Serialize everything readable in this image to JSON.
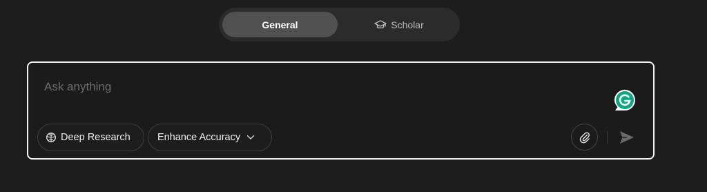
{
  "mode_toggle": {
    "tabs": [
      {
        "label": "General",
        "selected": true
      },
      {
        "label": "Scholar",
        "icon": "graduation-cap-icon",
        "selected": false
      }
    ]
  },
  "input": {
    "placeholder": "Ask anything",
    "value": ""
  },
  "toolbar": {
    "deep_research_label": "Deep Research",
    "deep_research_icon": "brain-icon",
    "enhance_label": "Enhance Accuracy",
    "enhance_icon": "chevron-down-icon",
    "attach_icon": "paperclip-icon",
    "send_icon": "send-icon"
  },
  "extension": {
    "icon": "grammarly-icon",
    "color": "#11a683"
  },
  "colors": {
    "background": "#1d1d1d",
    "selected_tab": "#505050",
    "input_border": "#f2f2f2"
  }
}
